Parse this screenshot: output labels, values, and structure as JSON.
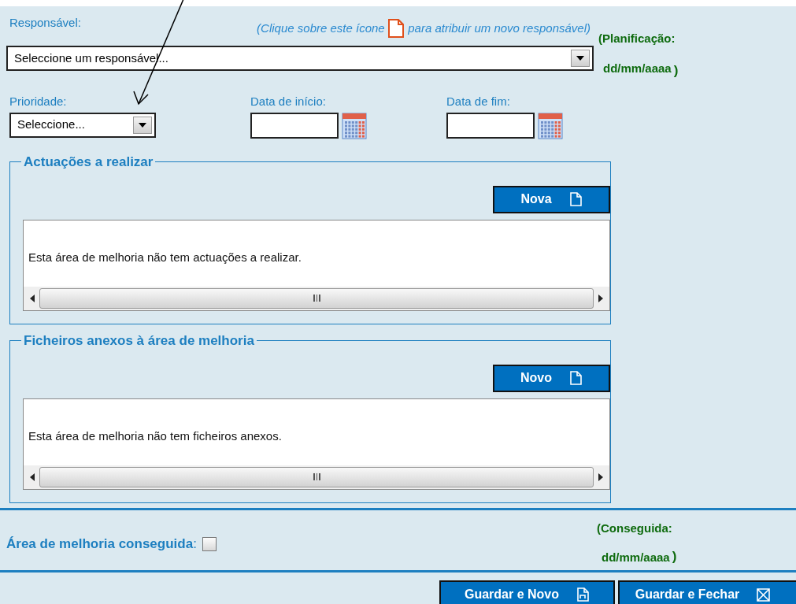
{
  "responsavel": {
    "label": "Responsável:",
    "hint_before": "(Clique sobre este ícone",
    "hint_after": "para atribuir um novo responsável)",
    "select_value": "Seleccione um responsável..."
  },
  "planificacao": {
    "label": "(Planificação:",
    "date": "dd/mm/aaaa",
    "close": ")"
  },
  "prioridade": {
    "label": "Prioridade:",
    "select_value": "Seleccione..."
  },
  "dates": [
    {
      "label": "Data de início:"
    },
    {
      "label": "Data de fim:"
    }
  ],
  "sections": [
    {
      "legend": "Actuações a realizar",
      "button": "Nova",
      "empty_text": "Esta área de melhoria não tem actuações a realizar."
    },
    {
      "legend": "Ficheiros anexos à área de melhoria",
      "button": "Novo",
      "empty_text": "Esta área de melhoria não tem ficheiros anexos."
    }
  ],
  "conseguida": {
    "label": "**Área de melhoria conseguida**:",
    "checked": false,
    "note_label": "(Conseguida:",
    "date": "dd/mm/aaaa",
    "close": ")"
  },
  "buttons": [
    {
      "label": "Guardar e Novo",
      "kind": "save-new"
    },
    {
      "label": "Guardar e Fechar",
      "kind": "save-close"
    }
  ]
}
